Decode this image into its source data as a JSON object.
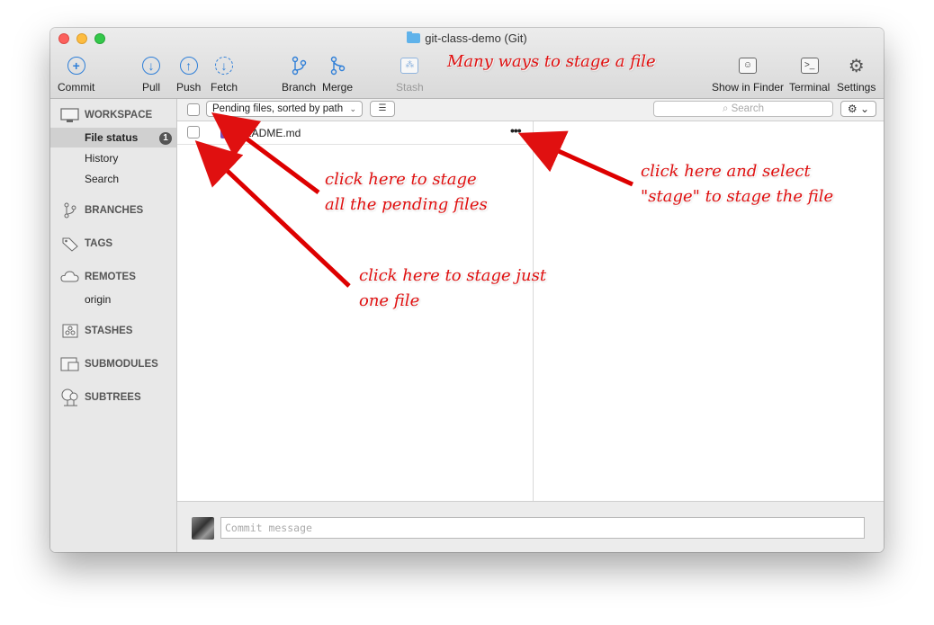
{
  "window": {
    "title": "git-class-demo (Git)"
  },
  "toolbar": {
    "commit": "Commit",
    "pull": "Pull",
    "push": "Push",
    "fetch": "Fetch",
    "branch": "Branch",
    "merge": "Merge",
    "stash": "Stash",
    "show_in_finder": "Show in Finder",
    "terminal": "Terminal",
    "settings": "Settings"
  },
  "sidebar": {
    "workspace": "WORKSPACE",
    "file_status": "File status",
    "file_status_count": "1",
    "history": "History",
    "search": "Search",
    "branches": "BRANCHES",
    "tags": "TAGS",
    "remotes": "REMOTES",
    "origin": "origin",
    "stashes": "STASHES",
    "submodules": "SUBMODULES",
    "subtrees": "SUBTREES"
  },
  "filterbar": {
    "sort_option": "Pending files, sorted by path",
    "search_placeholder": "Search"
  },
  "files": [
    {
      "name": "README.md",
      "status": "?"
    }
  ],
  "commit": {
    "placeholder": "Commit message"
  },
  "annotations": {
    "headline": "Many ways to stage a file",
    "stage_all": "click here to stage\nall the pending files",
    "stage_one": "click here to stage just\none file",
    "stage_menu": "click here and select\n\"stage\" to stage the file"
  }
}
